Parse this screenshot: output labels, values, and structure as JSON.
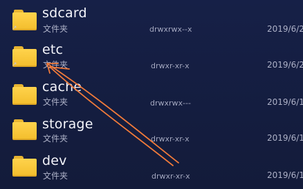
{
  "colors": {
    "background": "#151d3f",
    "folder": "#f9c83a",
    "annotation_arrow": "#f07a3a"
  },
  "files": [
    {
      "name": "sdcard",
      "type": "文件夹",
      "permissions": "drwxrwx--x",
      "date": "2019/6/2",
      "icon": "folder-icon",
      "symlink": true
    },
    {
      "name": "etc",
      "type": "文件夹",
      "permissions": "drwxr-xr-x",
      "date": "2019/6/2",
      "icon": "folder-icon",
      "symlink": true
    },
    {
      "name": "cache",
      "type": "文件夹",
      "permissions": "drwxrwx---",
      "date": "2019/6/1",
      "icon": "folder-icon",
      "symlink": false
    },
    {
      "name": "storage",
      "type": "文件夹",
      "permissions": "drwxr-xr-x",
      "date": "2019/6/1",
      "icon": "folder-icon",
      "symlink": false
    },
    {
      "name": "dev",
      "type": "文件夹",
      "permissions": "drwxr-xr-x",
      "date": "2019/6/1",
      "icon": "folder-icon",
      "symlink": false
    }
  ],
  "annotation": {
    "type": "hand-drawn arrows",
    "icon": "arrow-annotation-icon"
  }
}
